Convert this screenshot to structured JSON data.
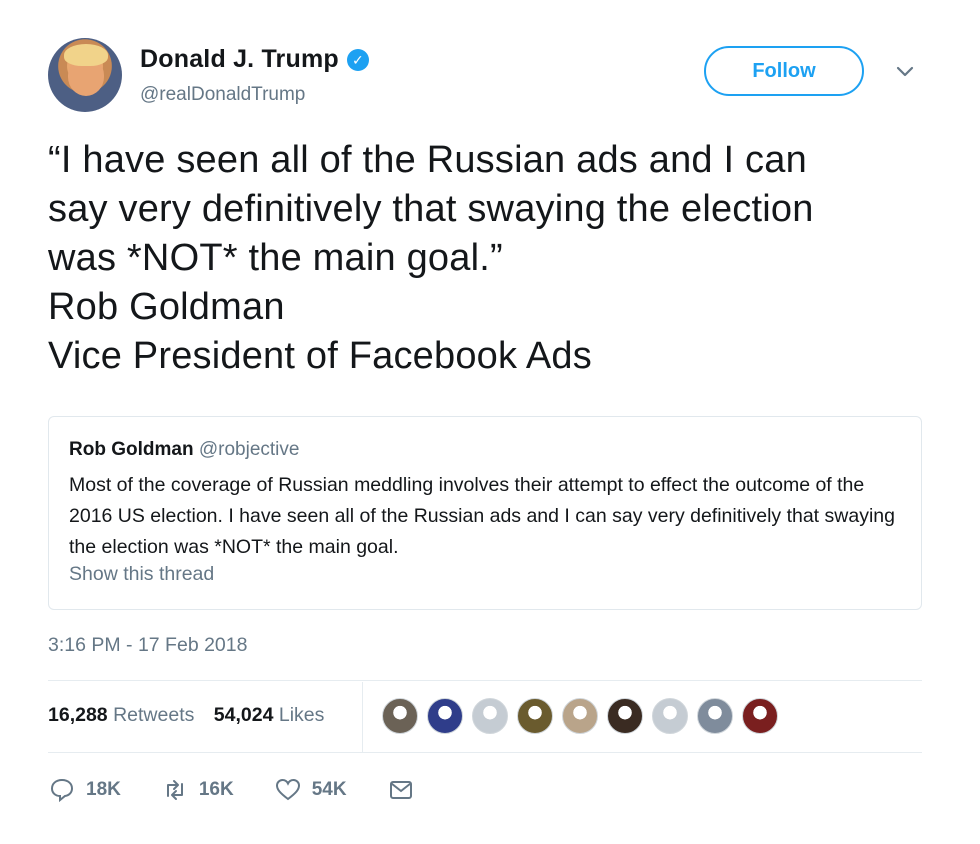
{
  "author": {
    "display_name": "Donald J. Trump",
    "handle": "@realDonaldTrump",
    "verified_mark": "✓"
  },
  "follow_label": "Follow",
  "tweet_lines": [
    "“I have seen all of the Russian ads and I can",
    "say very definitively that swaying the election",
    "was *NOT* the main goal.”",
    "Rob Goldman",
    "Vice President of Facebook Ads"
  ],
  "quoted_tweet": {
    "name": "Rob Goldman",
    "handle": "@robjective",
    "text": "Most of the coverage of Russian meddling involves their attempt to effect the outcome of the 2016 US election.  I have seen all of the Russian ads and I can say very definitively that swaying the election was *NOT* the main goal.",
    "show_thread_label": "Show this thread"
  },
  "timestamp": "3:16 PM - 17 Feb 2018",
  "stats": {
    "retweets_count": "16,288",
    "retweets_label": "Retweets",
    "likes_count": "54,024",
    "likes_label": "Likes"
  },
  "liker_avatar_colors": [
    "#6b6256",
    "#2f3d8a",
    "#c5ccd3",
    "#6a5b2e",
    "#b9a48a",
    "#3a2b22",
    "#c5ccd3",
    "#7f8c9c",
    "#7a1f1f"
  ],
  "actions": {
    "reply_count": "18K",
    "retweet_count": "16K",
    "like_count": "54K"
  },
  "colors": {
    "accent": "#1da1f2",
    "muted": "#657786"
  }
}
